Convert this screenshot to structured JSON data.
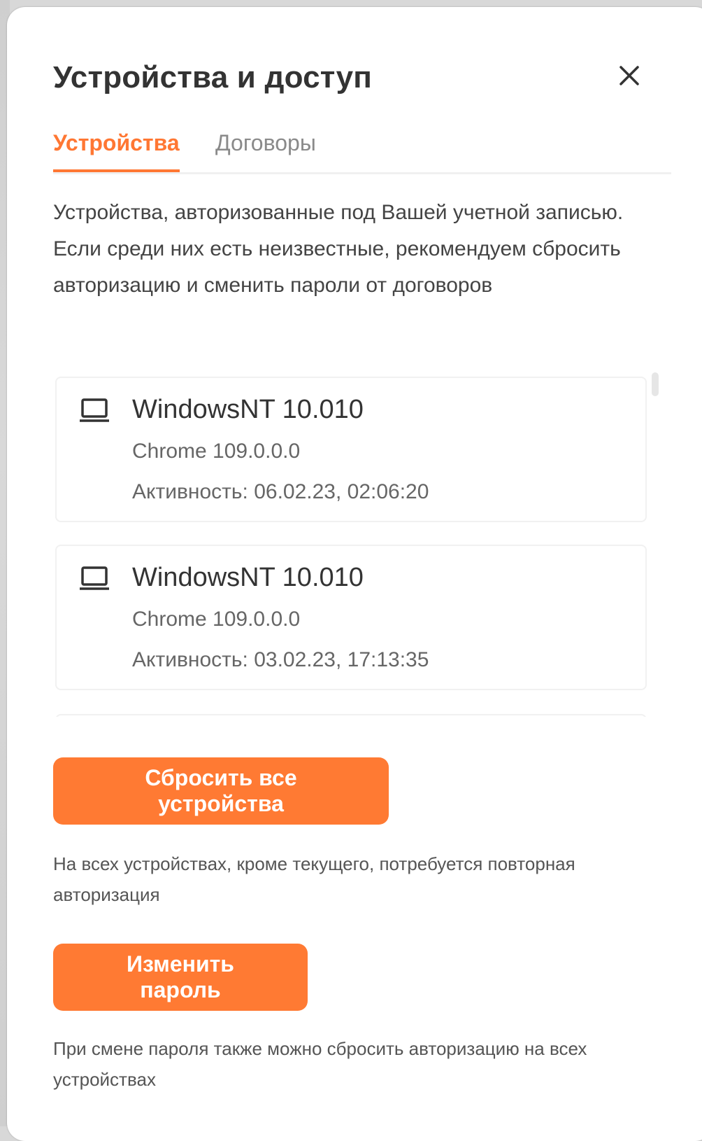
{
  "modal": {
    "title": "Устройства и доступ",
    "close_icon": "close-icon"
  },
  "tabs": [
    {
      "label": "Устройства",
      "active": true
    },
    {
      "label": "Договоры",
      "active": false
    }
  ],
  "description": "Устройства, авторизованные под Вашей учетной записью. Если среди них есть неизвестные, рекомендуем сбросить авторизацию и сменить пароли от договоров",
  "devices": [
    {
      "icon": "laptop-icon",
      "name": "WindowsNT 10.010",
      "browser": "Chrome 109.0.0.0",
      "activity": "Активность: 06.02.23, 02:06:20"
    },
    {
      "icon": "laptop-icon",
      "name": "WindowsNT 10.010",
      "browser": "Chrome 109.0.0.0",
      "activity": "Активность: 03.02.23, 17:13:35"
    }
  ],
  "actions": {
    "reset_label": "Сбросить все устройства",
    "reset_hint": "На всех устройствах, кроме текущего, потребуется повторная авторизация",
    "password_label": "Изменить пароль",
    "password_hint": "При смене пароля также можно сбросить авторизацию на всех устройствах"
  },
  "colors": {
    "accent": "#ff7a33",
    "active_tab": "#ff7733",
    "text_primary": "#333333",
    "text_secondary": "#666666",
    "inactive_tab": "#8a8a8a"
  }
}
